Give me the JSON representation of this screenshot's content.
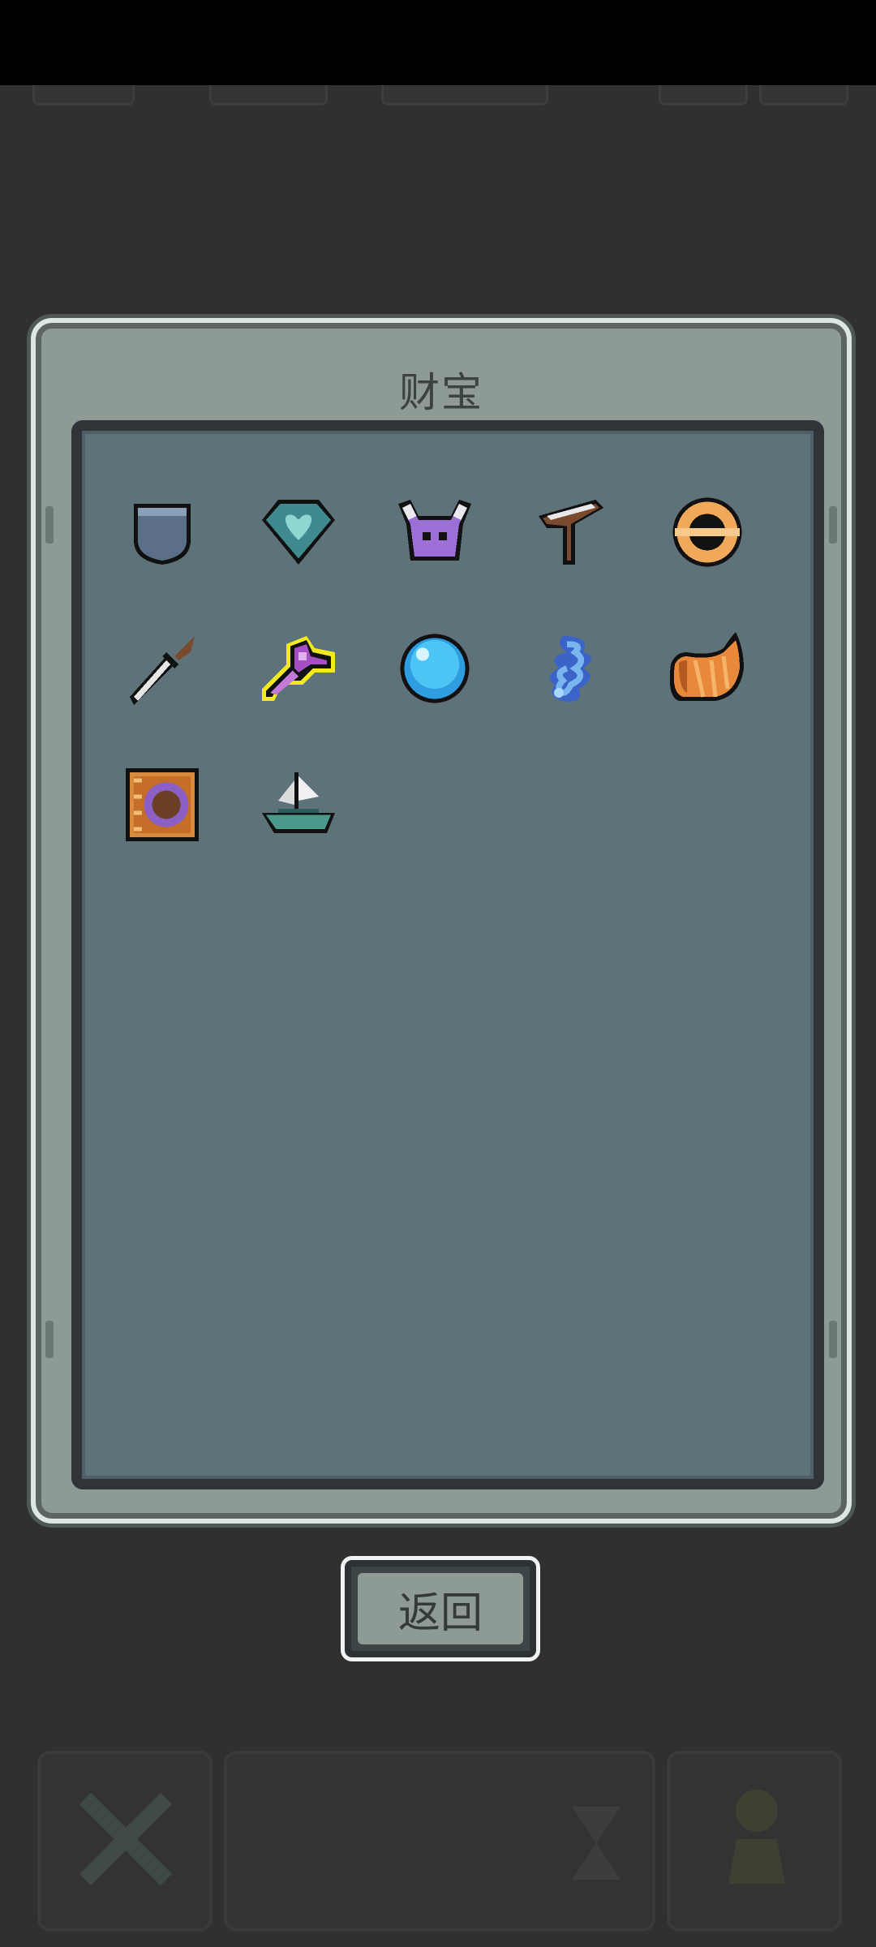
{
  "panel": {
    "title": "财宝",
    "treasures": [
      {
        "name": "pocket",
        "icon": "pocket-icon",
        "row": 0,
        "col": 0
      },
      {
        "name": "heart-gem",
        "icon": "heart-gem-icon",
        "row": 0,
        "col": 1
      },
      {
        "name": "horned-helmet",
        "icon": "horned-helmet-icon",
        "row": 0,
        "col": 2
      },
      {
        "name": "slingshot",
        "icon": "slingshot-icon",
        "row": 0,
        "col": 3
      },
      {
        "name": "gold-ring",
        "icon": "gold-ring-icon",
        "row": 0,
        "col": 4
      },
      {
        "name": "dagger",
        "icon": "dagger-icon",
        "row": 1,
        "col": 0
      },
      {
        "name": "magic-key",
        "icon": "magic-key-icon",
        "row": 1,
        "col": 1,
        "highlighted": true
      },
      {
        "name": "blue-orb",
        "icon": "blue-orb-icon",
        "row": 1,
        "col": 2
      },
      {
        "name": "blue-flame",
        "icon": "blue-flame-icon",
        "row": 1,
        "col": 3
      },
      {
        "name": "cornucopia",
        "icon": "cornucopia-icon",
        "row": 1,
        "col": 4
      },
      {
        "name": "spell-book",
        "icon": "spell-book-icon",
        "row": 2,
        "col": 0
      },
      {
        "name": "ship",
        "icon": "ship-icon",
        "row": 2,
        "col": 1
      }
    ]
  },
  "back_button": {
    "label": "返回"
  },
  "colors": {
    "panel_frame": "#8e9b94",
    "panel_inner": "#5e727a",
    "background": "#303030",
    "highlight": "#f2ea1c"
  }
}
